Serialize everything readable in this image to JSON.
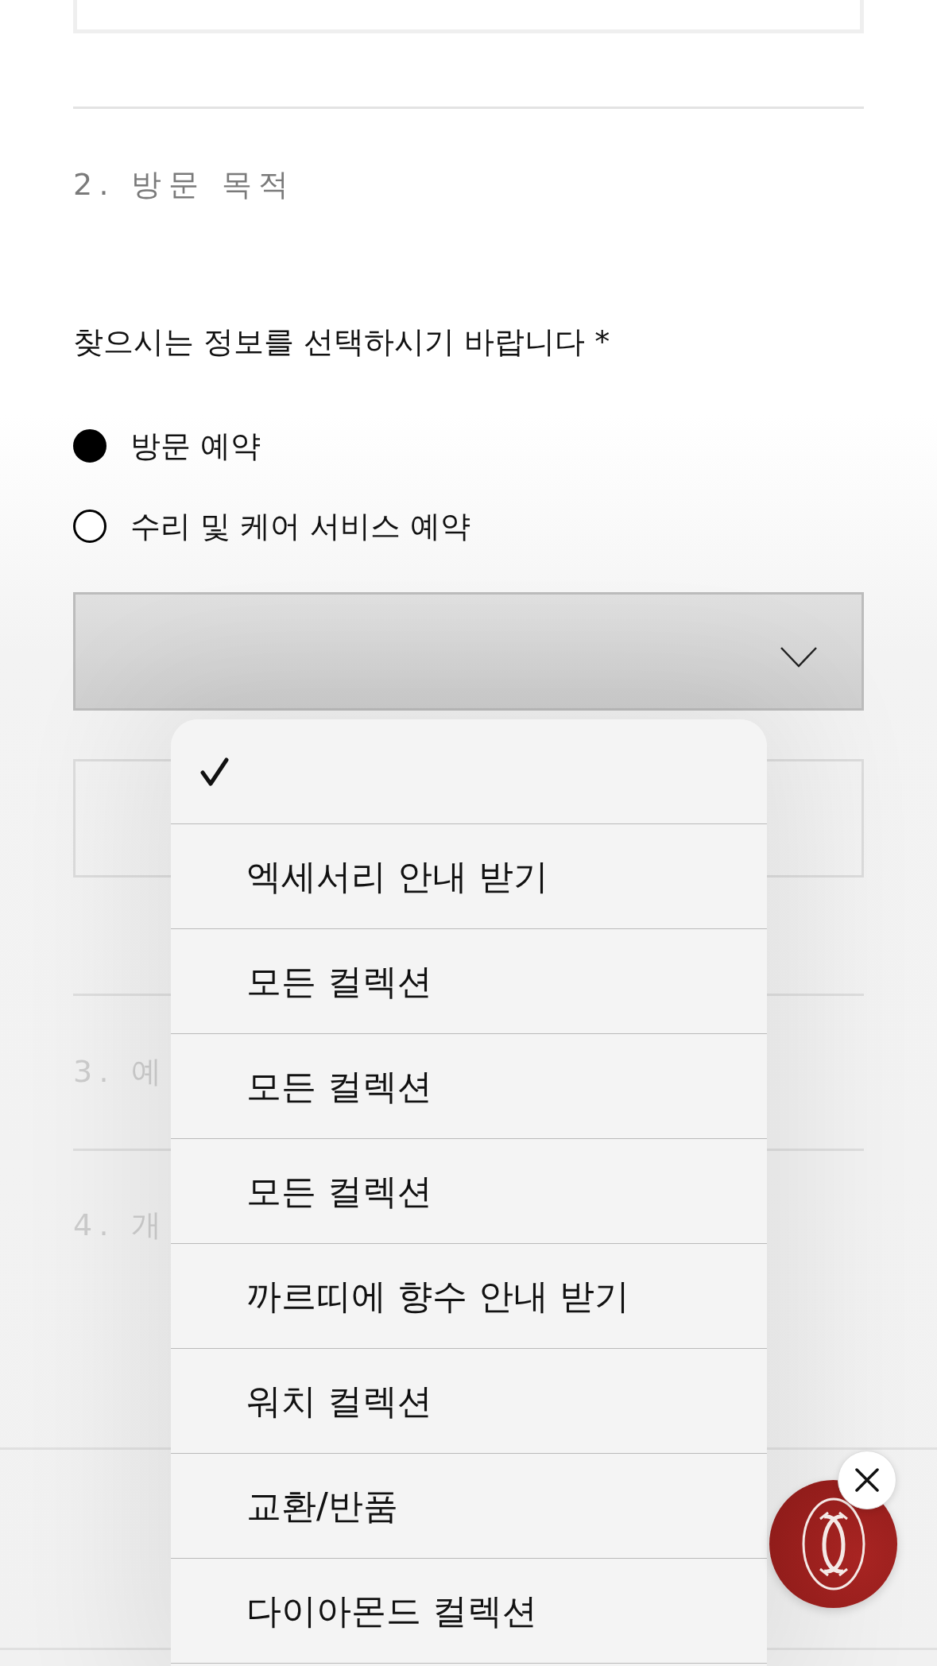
{
  "sections": [
    {
      "title": "2. 방문 목적",
      "active": true
    },
    {
      "title": "3. 예",
      "active": false
    },
    {
      "title": "4. 개",
      "active": false
    }
  ],
  "question": {
    "label": "찾으시는 정보를 선택하시기 바랍니다 *"
  },
  "radio_options": [
    {
      "label": "방문 예약",
      "selected": true
    },
    {
      "label": "수리 및 케어 서비스 예약",
      "selected": false
    }
  ],
  "select": {
    "expanded": true
  },
  "dropdown_menu": {
    "items": [
      {
        "selected": true
      },
      {
        "label": "엑세서리 안내 받기",
        "selected": false
      },
      {
        "label": "모든 컬렉션",
        "selected": false
      },
      {
        "label": "모든 컬렉션",
        "selected": false
      },
      {
        "label": "모든 컬렉션",
        "selected": false
      },
      {
        "label": "까르띠에 향수 안내 받기",
        "selected": false
      },
      {
        "label": "워치 컬렉션",
        "selected": false
      },
      {
        "label": "교환/반품",
        "selected": false
      },
      {
        "label": "다이아몬드 컬렉션",
        "selected": false
      }
    ]
  }
}
